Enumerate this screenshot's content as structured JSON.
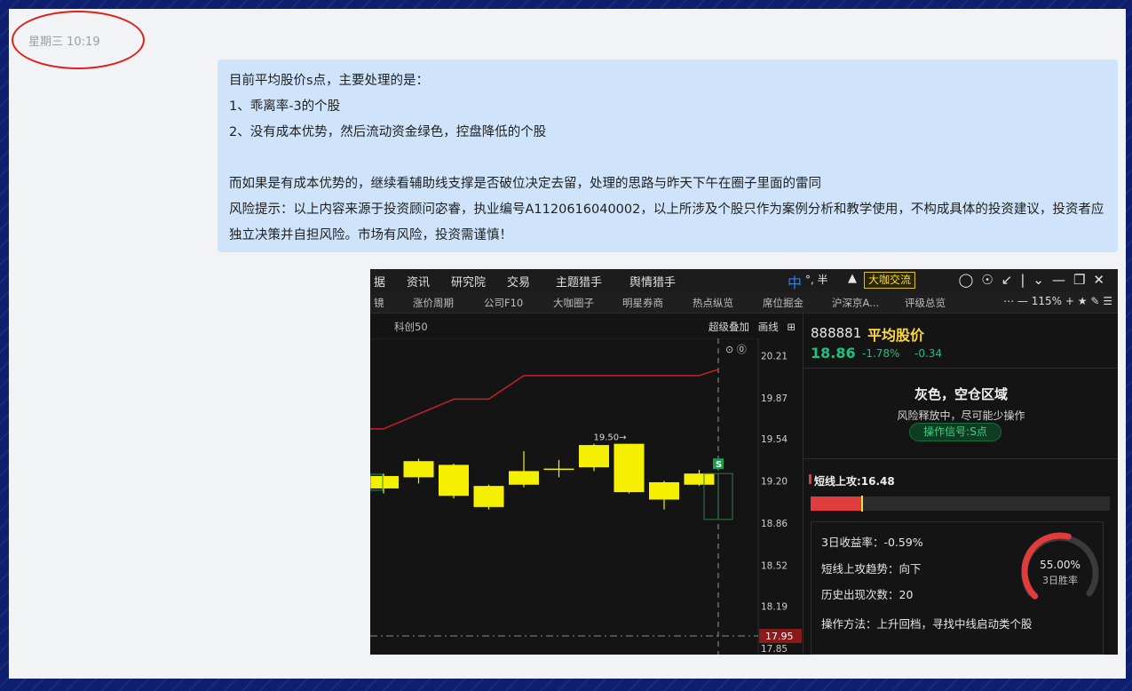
{
  "chat": {
    "timestamp": "星期三 10:19",
    "message_lines": [
      "目前平均股价s点，主要处理的是：",
      "1、乖离率-3的个股",
      "2、没有成本优势，然后流动资金绿色，控盘降低的个股",
      "",
      "而如果是有成本优势的，继续看辅助线支撑是否破位决定去留，处理的思路与昨天下午在圈子里面的雷同",
      "风险提示：以上内容来源于投资顾问宓睿，执业编号A1120616040002，以上所涉及个股只作为案例分析和教学使用，不构成具体的投资建议，投资者应独立决策并自担风险。市场有风险，投资需谨慎！"
    ]
  },
  "app": {
    "menu": [
      "据",
      "资讯",
      "研究院",
      "交易",
      "主题猎手",
      "舆情猎手"
    ],
    "top_right": {
      "ime": "中",
      "ime_extra": "°, 半",
      "daka_button": "大咖交流"
    },
    "tabs": [
      "镜",
      "涨价周期",
      "公司F10",
      "大咖圈子",
      "明星券商",
      "热点纵览",
      "席位掘金",
      "沪深京A...",
      "评级总览"
    ],
    "zoom": "115%",
    "chart": {
      "symbol_label": "科创50",
      "ops": [
        "超级叠加",
        "画线"
      ],
      "price_axis": [
        "20.21",
        "19.87",
        "19.54",
        "19.20",
        "18.86",
        "18.52",
        "18.19",
        "17.85"
      ],
      "current_price_tag": "17.95",
      "peak_label": "19.50",
      "signal_mark": "S"
    },
    "quote": {
      "code": "888881",
      "name": "平均股价",
      "price": "18.86",
      "change_pct": "-1.78%",
      "change": "-0.34"
    },
    "zone": {
      "title": "灰色，空仓区域",
      "subtitle": "风险释放中，尽可能少操作",
      "signal": "操作信号:S点"
    },
    "short_attack": {
      "label": "短线上攻:16.48",
      "fill_fraction": 0.17
    },
    "stats": {
      "return_3d": "3日收益率：-0.59%",
      "trend": "短线上攻趋势：向下",
      "occurrences": "历史出现次数：20",
      "method": "操作方法：上升回档，寻找中线启动类个股",
      "win_rate": "55.00%",
      "win_rate_label": "3日胜率"
    }
  },
  "chart_data": {
    "type": "candlestick",
    "y_ticks": [
      20.21,
      19.87,
      19.54,
      19.2,
      18.86,
      18.52,
      18.19,
      17.85
    ],
    "ylim": [
      17.8,
      20.35
    ],
    "candles": [
      {
        "open": 19.14,
        "close": 19.24,
        "high": 19.26,
        "low": 19.1
      },
      {
        "open": 19.23,
        "close": 19.36,
        "high": 19.38,
        "low": 19.18
      },
      {
        "open": 19.33,
        "close": 19.08,
        "high": 19.34,
        "low": 19.06
      },
      {
        "open": 19.16,
        "close": 18.99,
        "high": 19.17,
        "low": 18.97
      },
      {
        "open": 19.17,
        "close": 19.28,
        "high": 19.44,
        "low": 19.15
      },
      {
        "open": 19.3,
        "close": 19.29,
        "high": 19.37,
        "low": 19.23
      },
      {
        "open": 19.31,
        "close": 19.49,
        "high": 19.5,
        "low": 19.28
      },
      {
        "open": 19.5,
        "close": 19.11,
        "high": 19.5,
        "low": 19.1
      },
      {
        "open": 19.19,
        "close": 19.05,
        "high": 19.2,
        "low": 18.97
      },
      {
        "open": 19.26,
        "close": 19.17,
        "high": 19.29,
        "low": 19.16
      },
      {
        "open": 19.26,
        "close": 18.89,
        "high": 19.26,
        "low": 18.89
      }
    ],
    "red_line": [
      19.62,
      19.74,
      19.86,
      19.86,
      20.05,
      20.05,
      20.05,
      20.05,
      20.05,
      20.05,
      20.1,
      20.1
    ],
    "reference_line": 17.95
  }
}
